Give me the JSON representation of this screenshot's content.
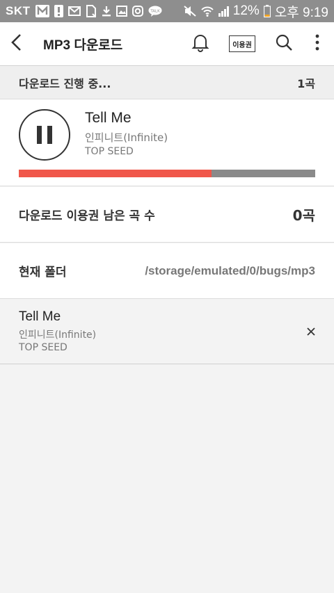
{
  "status_bar": {
    "carrier": "SKT",
    "battery": "12%",
    "time": "오후 9:19",
    "icons": [
      "m-app-icon",
      "alert-icon",
      "mail-icon",
      "sim-icon",
      "download-icon",
      "image-icon",
      "instagram-icon",
      "talk-icon",
      "mute-icon",
      "wifi-icon",
      "signal-icon",
      "battery-icon"
    ]
  },
  "appbar": {
    "title": "MP3 다운로드",
    "pass_label": "이용권",
    "icons": [
      "back-arrow-icon",
      "bell-icon",
      "search-icon",
      "more-vert-icon"
    ]
  },
  "download_status": {
    "label": "다운로드 진행 중...",
    "count": "1곡"
  },
  "current_track": {
    "title": "Tell Me",
    "artist": "인피니트(Infinite)",
    "album": "TOP SEED",
    "progress_fraction": 0.65
  },
  "remaining": {
    "label": "다운로드 이용권 남은 곡 수",
    "value": "0곡"
  },
  "folder": {
    "label": "현재 폴더",
    "path": "/storage/emulated/0/bugs/mp3"
  },
  "queue": [
    {
      "title": "Tell Me",
      "artist": "인피니트(Infinite)",
      "album": "TOP SEED"
    }
  ],
  "colors": {
    "status_bar": "#8e8e8e",
    "progress_fill": "#f0574a",
    "progress_track": "#8a8a8a",
    "background": "#f3f3f3"
  }
}
